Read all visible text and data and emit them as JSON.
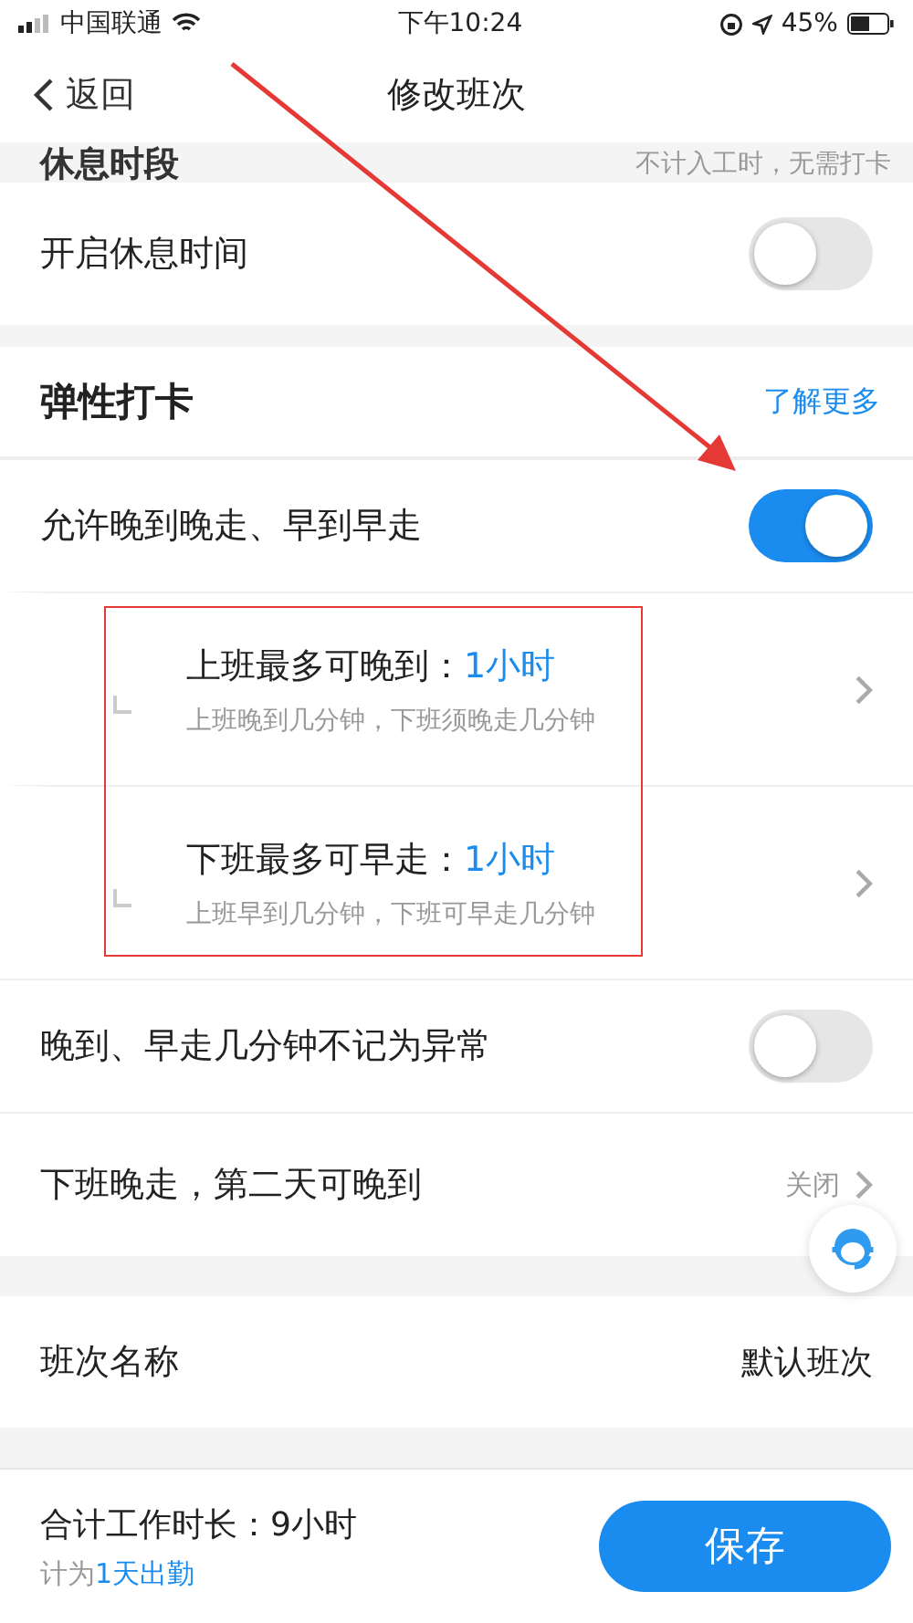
{
  "status_bar": {
    "carrier": "中国联通",
    "time": "下午10:24",
    "battery": "45%"
  },
  "nav": {
    "back": "返回",
    "title": "修改班次"
  },
  "rest_section": {
    "title": "休息时段",
    "note": "不计入工时，无需打卡"
  },
  "rest_toggle": {
    "label": "开启休息时间",
    "on": false
  },
  "flex_section": {
    "title": "弹性打卡",
    "link": "了解更多"
  },
  "flex_rows": [
    {
      "kind": "toggle",
      "label": "允许晚到晚走、早到早走",
      "on": true
    },
    {
      "kind": "sub",
      "label": "上班最多可晚到：",
      "value": "1小时",
      "hint": "上班晚到几分钟，下班须晚走几分钟"
    },
    {
      "kind": "sub",
      "label": "下班最多可早走：",
      "value": "1小时",
      "hint": "上班早到几分钟，下班可早走几分钟"
    },
    {
      "kind": "toggle",
      "label": "晚到、早走几分钟不记为异常",
      "on": false
    },
    {
      "kind": "link",
      "label": "下班晚走，第二天可晚到",
      "value": "关闭"
    }
  ],
  "shift_name": {
    "label": "班次名称",
    "value": "默认班次"
  },
  "footer": {
    "total": "合计工作时长：9小时",
    "count_prefix": "计为",
    "count_value": "1天出勤",
    "save": "保存"
  },
  "annotations": {
    "arrow": true,
    "frame": true
  }
}
